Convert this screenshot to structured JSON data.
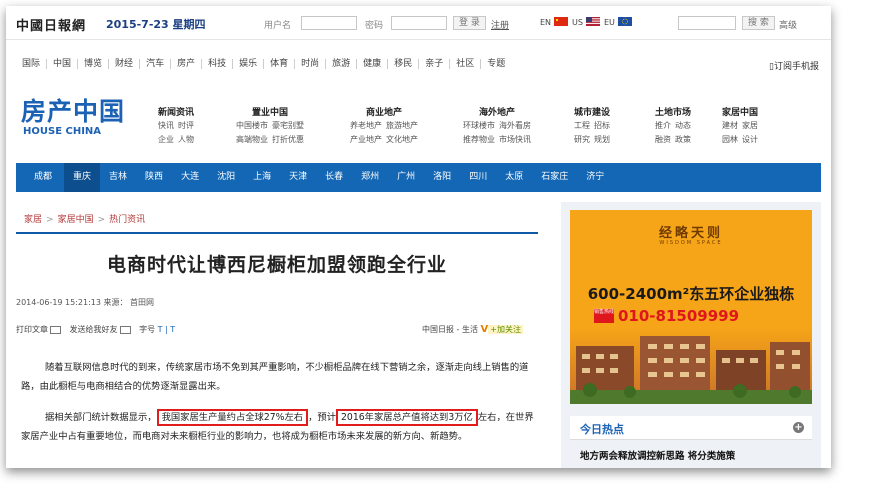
{
  "topbar": {
    "brand": "中國日報網",
    "date": "2015-7-23 星期四",
    "username_label": "用户名",
    "password_label": "密码",
    "login_button": "登 录",
    "register_link": "注册",
    "lang_en": "EN",
    "lang_us": "US",
    "lang_eu": "EU",
    "search_button": "搜 索",
    "advanced_link": "高级"
  },
  "channels": [
    "国际",
    "中国",
    "博览",
    "财经",
    "汽车",
    "房产",
    "科技",
    "娱乐",
    "体育",
    "时尚",
    "旅游",
    "健康",
    "移民",
    "亲子",
    "社区",
    "专题"
  ],
  "mobile_subscribe": "订阅手机报",
  "logo": {
    "cn": "房产中国",
    "en": "HOUSE CHINA"
  },
  "section_nav": [
    {
      "title": "新闻资讯",
      "rows": [
        [
          "快讯",
          "时评"
        ],
        [
          "企业",
          "人物"
        ]
      ]
    },
    {
      "title": "置业中国",
      "rows": [
        [
          "中国楼市",
          "豪宅别墅"
        ],
        [
          "高端物业",
          "打折优惠"
        ]
      ]
    },
    {
      "title": "商业地产",
      "rows": [
        [
          "养老地产",
          "旅游地产"
        ],
        [
          "产业地产",
          "文化地产"
        ]
      ]
    },
    {
      "title": "海外地产",
      "rows": [
        [
          "环球楼市",
          "海外看房"
        ],
        [
          "推荐物业",
          "市场快讯"
        ]
      ]
    },
    {
      "title": "城市建设",
      "rows": [
        [
          "工程",
          "招标"
        ],
        [
          "研究",
          "规划"
        ]
      ]
    },
    {
      "title": "土地市场",
      "rows": [
        [
          "推介",
          "动态"
        ],
        [
          "融资",
          "政策"
        ]
      ]
    },
    {
      "title": "家居中国",
      "rows": [
        [
          "建材",
          "家居"
        ],
        [
          "园林",
          "设计"
        ]
      ]
    }
  ],
  "cities": [
    "成都",
    "重庆",
    "吉林",
    "陕西",
    "大连",
    "沈阳",
    "上海",
    "天津",
    "长春",
    "郑州",
    "广州",
    "洛阳",
    "四川",
    "太原",
    "石家庄",
    "济宁"
  ],
  "breadcrumb": [
    "家居",
    "家居中国",
    "热门资讯"
  ],
  "article": {
    "title": "电商时代让博西尼橱柜加盟领跑全行业",
    "meta": "2014-06-19 15:21:13 来源： 首田网",
    "print_label": "打印文章",
    "send_label": "发送给我好友",
    "fontsize_label": "字号",
    "fontsize_options": "T | T",
    "source_label": "中国日报 - 生活",
    "follow_label": "+加关注",
    "p1": "随着互联网信息时代的到来，传统家居市场不免到其严重影响，不少橱柜品牌在线下营销之余，逐渐走向线上销售的道路，由此橱柜与电商相结合的优势逐渐显露出来。",
    "p2_a": "据相关部门统计数据显示，",
    "p2_hl1": "我国家居生产量约占全球27%左右",
    "p2_b": "，预计",
    "p2_hl2": "2016年家居总产值将达到3万亿",
    "p2_c": "左右，在世界家居产业中占有重要地位，而电商对未来橱柜行业的影响力，也将成为橱柜市场未来发展的新方向、新趋势。"
  },
  "ad": {
    "brand": "经略天则",
    "brand_en": "WISDOM SPACE",
    "headline": "600-2400m²东五环企业独栋",
    "phone_tag": "销售热线",
    "phone": "010-81509999"
  },
  "hot": {
    "title": "今日热点",
    "plus": "+",
    "item": "地方两会释放调控新思路 将分类施策"
  },
  "colors": {
    "brand_blue": "#1467b4",
    "highlight_red": "#e01c1c",
    "ad_orange": "#f6a418"
  }
}
